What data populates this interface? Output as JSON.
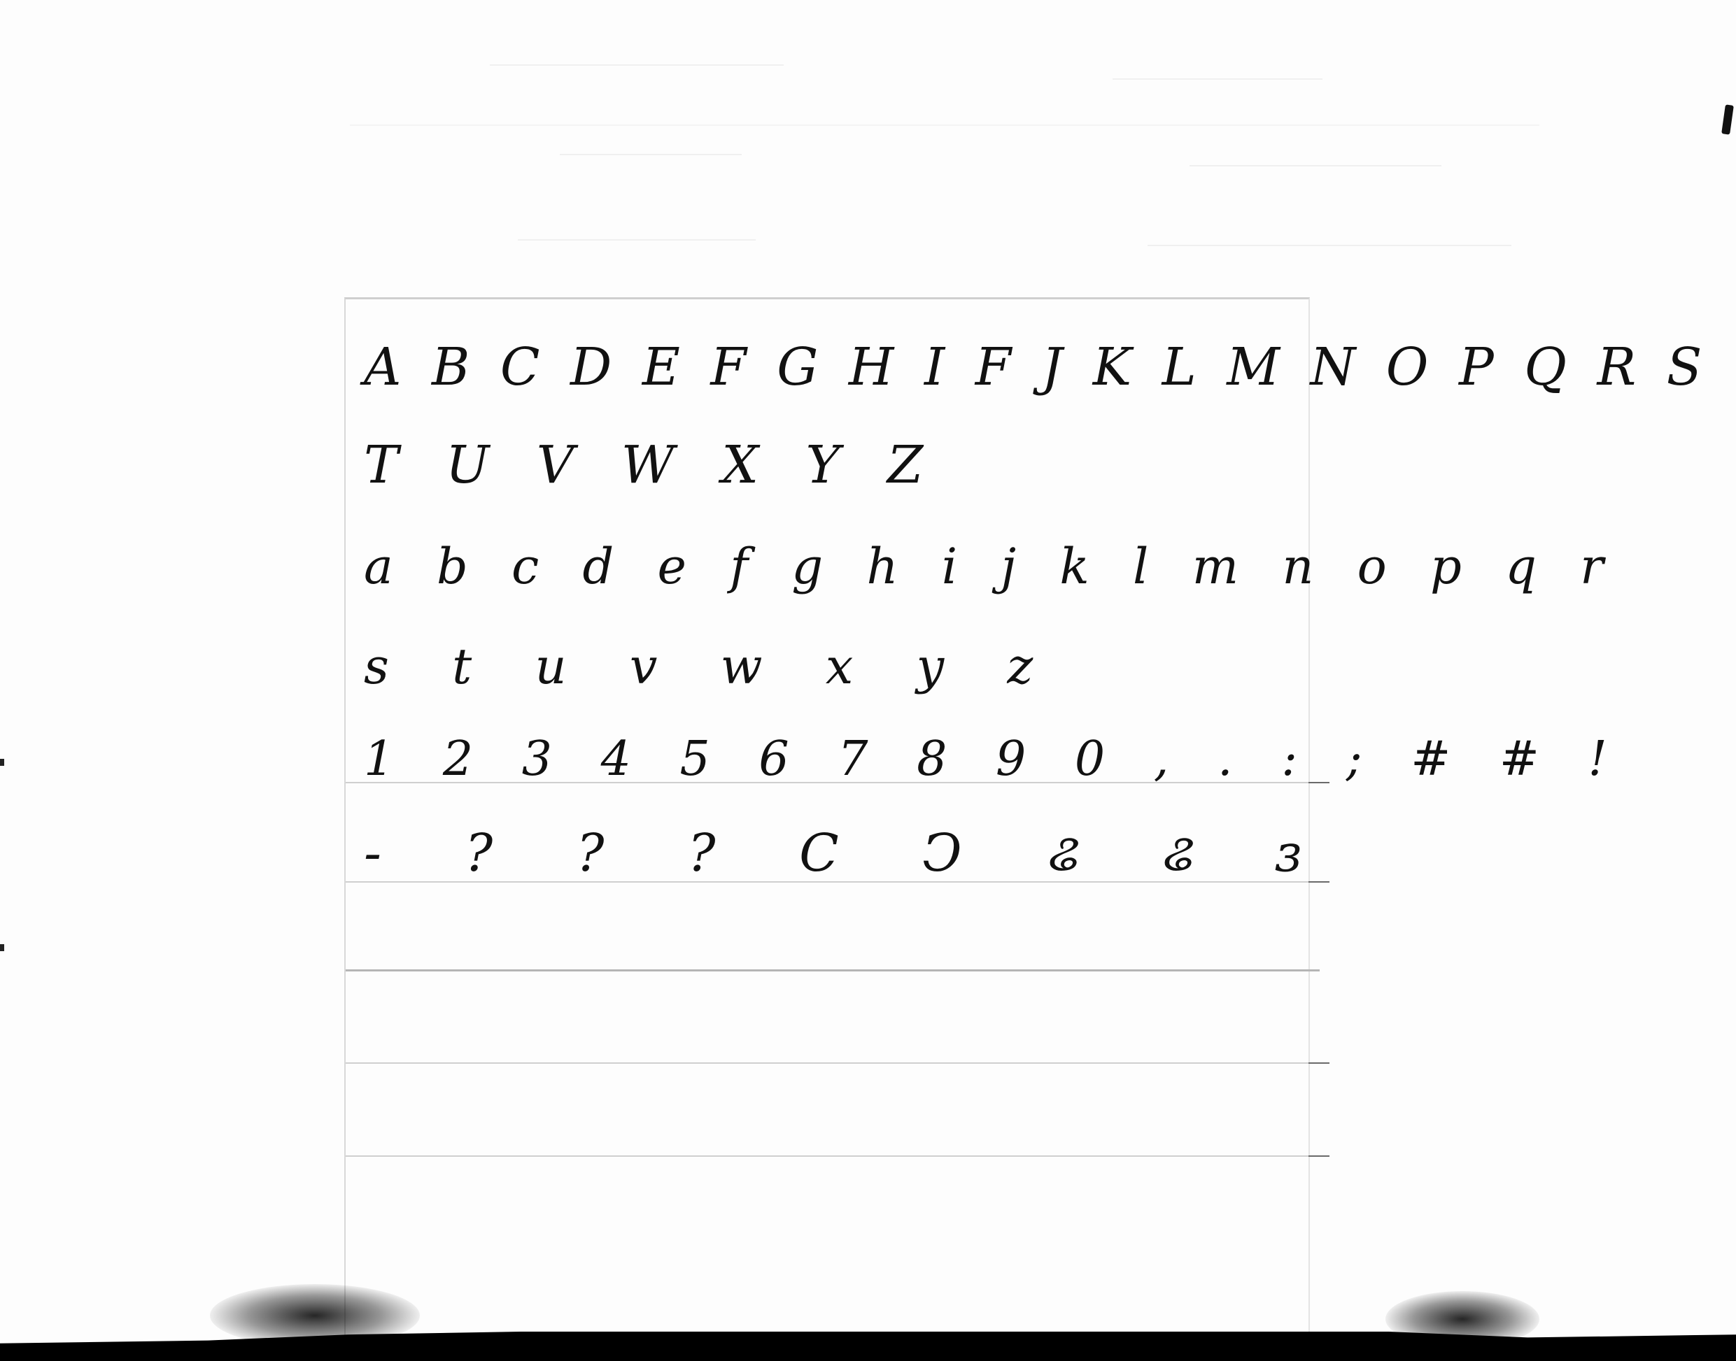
{
  "handwriting": {
    "lines": [
      "A B C D E F G H I F J K L M N O P Q R S",
      "T U V W X Y Z",
      "a b c d e f g h i j k l m n o p q r",
      "s t u v w x y z",
      "1 2 3 4 5 6 7 8 9 0 , . : ; # # !",
      "- ? ? ? C Ↄ ଌ ଌ ɜ"
    ]
  },
  "colors": {
    "ink": "#111111",
    "paper": "#ffffff",
    "rule": "#cfcfcf"
  }
}
